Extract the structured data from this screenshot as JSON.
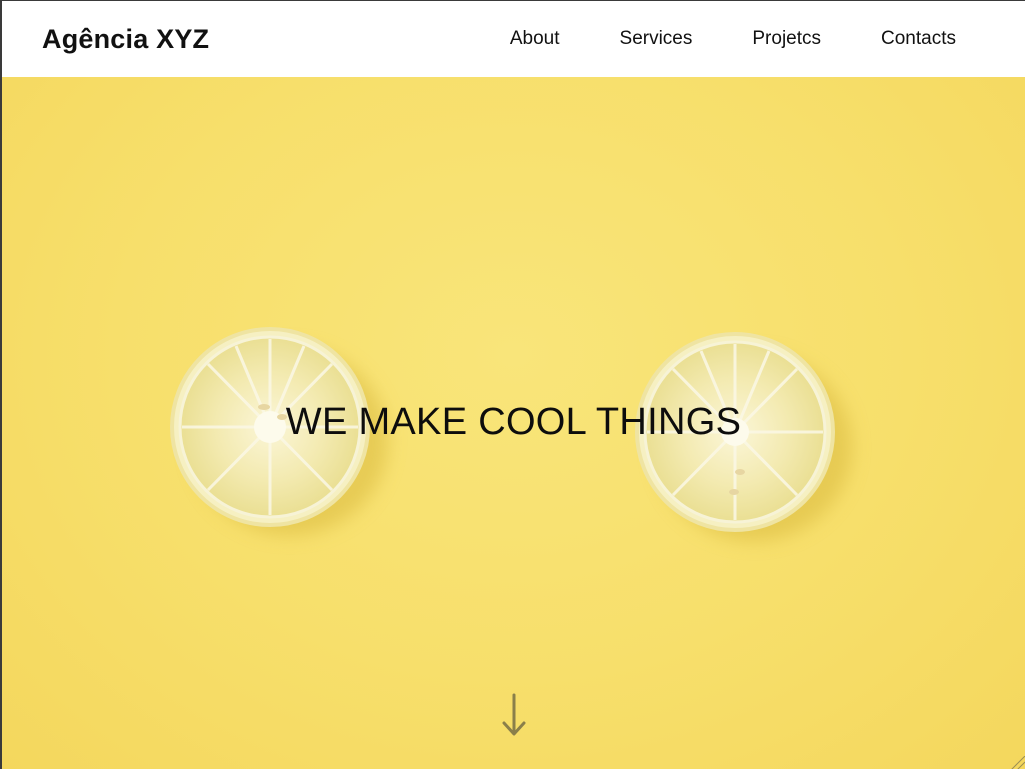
{
  "header": {
    "brand": "Agência XYZ",
    "nav": [
      {
        "label": "About"
      },
      {
        "label": "Services"
      },
      {
        "label": "Projetcs"
      },
      {
        "label": "Contacts"
      }
    ]
  },
  "hero": {
    "headline": "WE MAKE COOL THINGS",
    "background_color": "#f7df6b",
    "scroll_icon": "arrow-down-icon",
    "image_description_icon": "lemon-slices"
  },
  "colors": {
    "text": "#111111",
    "header_bg": "#ffffff",
    "arrow": "#8a7f4a"
  }
}
